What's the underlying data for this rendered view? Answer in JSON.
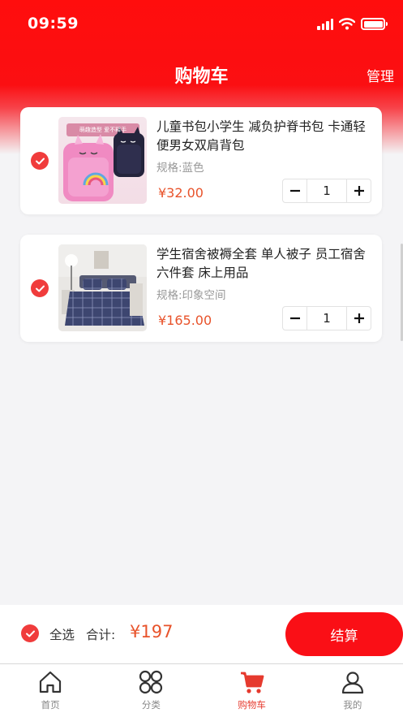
{
  "status_bar": {
    "time": "09:59"
  },
  "nav": {
    "title": "购物车",
    "manage": "管理"
  },
  "items": [
    {
      "title": "儿童书包小学生 减负护脊书包 卡通轻便男女双肩背包",
      "spec": "规格:蓝色",
      "price": "¥32.00",
      "quantity": "1",
      "thumb_caption": "萌趣造型 爱不释手"
    },
    {
      "title": "学生宿舍被褥全套 单人被子 员工宿舍六件套 床上用品",
      "spec": "规格:印象空间",
      "price": "¥165.00",
      "quantity": "1"
    }
  ],
  "checkout": {
    "select_all": "全选",
    "total_label": "合计:",
    "total_amount": "¥197",
    "button": "结算"
  },
  "tabbar": [
    {
      "label": "首页",
      "icon": "home-icon"
    },
    {
      "label": "分类",
      "icon": "category-icon"
    },
    {
      "label": "购物车",
      "icon": "cart-icon",
      "active": true
    },
    {
      "label": "我的",
      "icon": "profile-icon"
    }
  ],
  "colors": {
    "primary_red": "#fa0f16",
    "price_orange": "#e8532b",
    "check_red": "#f03c3c"
  }
}
